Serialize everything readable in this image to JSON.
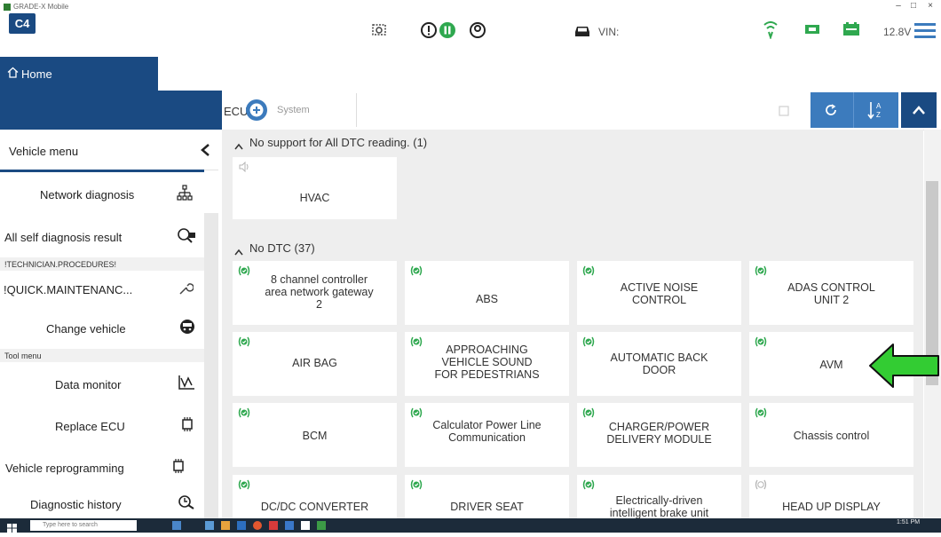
{
  "window": {
    "title": "GRADE-X Mobile",
    "controls": [
      "–",
      "□",
      "×"
    ]
  },
  "header": {
    "logo": "C4",
    "vin_label": "VIN:",
    "voltage": "12.8V",
    "colors": {
      "brand_blue": "#1a4a82",
      "green": "#2fa84f"
    },
    "icons": [
      "camera-icon",
      "alert-icon",
      "pause-icon",
      "user-icon",
      "car-icon",
      "signal-icon",
      "connection-icon",
      "battery-icon",
      "hamburger-menu-icon"
    ]
  },
  "home_tab": {
    "label": "Home"
  },
  "toolbar": {
    "ecu_label": "ECU",
    "system_label": "System"
  },
  "sidebar": {
    "title": "Vehicle menu",
    "items": [
      {
        "label": "Network diagnosis",
        "icon": "network-icon"
      },
      {
        "label": "All self diagnosis result",
        "icon": "car-search-icon"
      }
    ],
    "category_technician": "!TECHNICIAN.PROCEDURES!",
    "quick_maintenance": "!QUICK.MAINTENANC...",
    "change_vehicle": "Change vehicle",
    "category_tool": "Tool menu",
    "tool_items": [
      {
        "label": "Data monitor",
        "icon": "data-monitor-icon"
      },
      {
        "label": "Replace ECU",
        "icon": "chip-icon"
      },
      {
        "label": "Vehicle reprogramming",
        "icon": "chip-icon"
      },
      {
        "label": "Diagnostic history",
        "icon": "history-icon"
      }
    ]
  },
  "groups": [
    {
      "header": "No support for All DTC reading. (1)",
      "tiles": [
        "HVAC"
      ]
    },
    {
      "header": "No DTC (37)",
      "tiles": [
        [
          "8 channel controller",
          "area network gateway",
          "2"
        ],
        [
          "ABS"
        ],
        [
          "ACTIVE NOISE",
          "CONTROL"
        ],
        [
          "ADAS CONTROL",
          "UNIT 2"
        ],
        [
          "AIR BAG"
        ],
        [
          "APPROACHING",
          "VEHICLE SOUND",
          "FOR PEDESTRIANS"
        ],
        [
          "AUTOMATIC BACK",
          "DOOR"
        ],
        [
          "AVM"
        ],
        [
          "BCM"
        ],
        [
          "Calculator Power Line",
          "Communication"
        ],
        [
          "CHARGER/POWER",
          "DELIVERY MODULE"
        ],
        [
          "Chassis control"
        ],
        [
          "DC/DC CONVERTER"
        ],
        [
          "DRIVER SEAT"
        ],
        [
          "Electrically-driven",
          "intelligent brake unit"
        ],
        [
          "HEAD UP DISPLAY"
        ]
      ]
    }
  ],
  "taskbar": {
    "search_placeholder": "Type here to search",
    "time": "1:51 PM"
  }
}
